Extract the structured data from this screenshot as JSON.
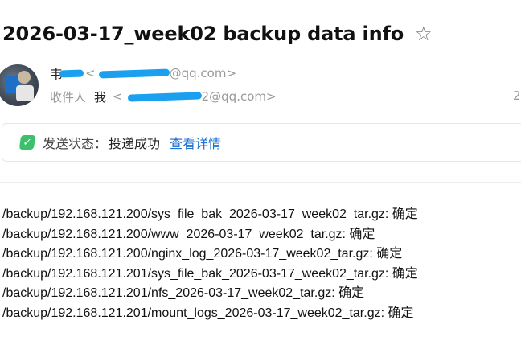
{
  "subject": "2026-03-17_week02 backup data info",
  "star_icon": "☆",
  "from": {
    "sender_name": "韦",
    "bracket_open": "<",
    "address_domain": "@qq.com>"
  },
  "to": {
    "label": "收件人",
    "name": "我",
    "bracket_open": "<",
    "address_tail": "2@qq.com>"
  },
  "side_number": "2",
  "status": {
    "check_icon": "✓",
    "label": "发送状态：",
    "value": "投递成功",
    "link": "查看详情",
    "check_color": "#3cc06a",
    "link_color": "#1a6fd1"
  },
  "body_lines": [
    "/backup/192.168.121.200/sys_file_bak_2026-03-17_week02_tar.gz: 确定",
    "/backup/192.168.121.200/www_2026-03-17_week02_tar.gz: 确定",
    "/backup/192.168.121.200/nginx_log_2026-03-17_week02_tar.gz: 确定",
    "/backup/192.168.121.201/sys_file_bak_2026-03-17_week02_tar.gz: 确定",
    "/backup/192.168.121.201/nfs_2026-03-17_week02_tar.gz: 确定",
    "/backup/192.168.121.201/mount_logs_2026-03-17_week02_tar.gz: 确定"
  ]
}
